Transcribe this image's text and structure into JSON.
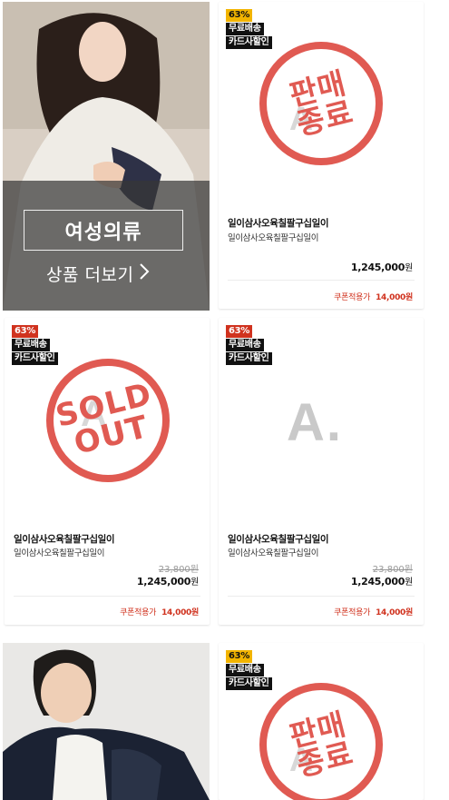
{
  "banner": {
    "category": "여성의류",
    "more": "상품 더보기",
    "arrow": "›"
  },
  "products": [
    {
      "discount": "63%",
      "discount_color": "#f2b400",
      "tags": [
        "무료배송",
        "카드사할인"
      ],
      "status": "판매종료",
      "stamp_line1": "판매",
      "stamp_line2": "종료",
      "name": "일이삼사오육칠팔구십일이",
      "desc": "일이삼사오육칠팔구십일이",
      "original_price": "",
      "price": "1,245,000",
      "currency": "원",
      "coupon_label": "쿠폰적용가",
      "coupon_price": "14,000원"
    },
    {
      "discount": "63%",
      "discount_color": "#d0321e",
      "tags": [
        "무료배송",
        "카드사할인"
      ],
      "status": "SOLD OUT",
      "stamp_line1": "SOLD",
      "stamp_line2": "OUT",
      "name": "일이삼사오육칠팔구십일이",
      "desc": "일이삼사오육칠팔구십일이",
      "original_price": "23,800원",
      "price": "1,245,000",
      "currency": "원",
      "coupon_label": "쿠폰적용가",
      "coupon_price": "14,000원"
    },
    {
      "discount": "63%",
      "discount_color": "#d0321e",
      "tags": [
        "무료배송",
        "카드사할인"
      ],
      "placeholder_logo": "A.",
      "name": "일이삼사오육칠팔구십일이",
      "desc": "일이삼사오육칠팔구십일이",
      "original_price": "23,800원",
      "price": "1,245,000",
      "currency": "원",
      "coupon_label": "쿠폰적용가",
      "coupon_price": "14,000원"
    },
    {
      "discount": "63%",
      "discount_color": "#f2b400",
      "tags": [
        "무료배송",
        "카드사할인"
      ],
      "status": "판매종료",
      "stamp_line1": "판매",
      "stamp_line2": "종료"
    }
  ],
  "colors": {
    "stamp": "#e05a52",
    "coupon": "#d0321e"
  }
}
